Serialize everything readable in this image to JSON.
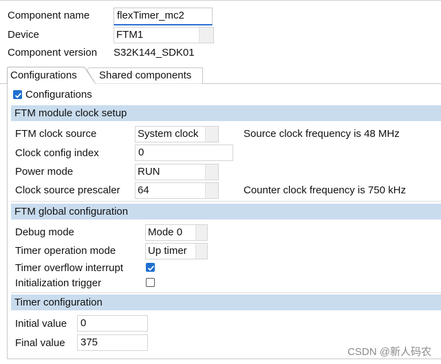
{
  "component": {
    "name_label": "Component name",
    "name_value": "flexTimer_mc2",
    "device_label": "Device",
    "device_value": "FTM1",
    "version_label": "Component version",
    "version_value": "S32K144_SDK01"
  },
  "tabs": [
    {
      "label": "Configurations",
      "active": true
    },
    {
      "label": "Shared components",
      "active": false
    }
  ],
  "configurations_checkbox": {
    "label": "Configurations",
    "checked": true
  },
  "clock_setup": {
    "title": "FTM module clock setup",
    "clock_source_label": "FTM clock source",
    "clock_source_value": "System clock",
    "source_freq_text": "Source clock frequency is 48 MHz",
    "config_index_label": "Clock config index",
    "config_index_value": "0",
    "power_mode_label": "Power mode",
    "power_mode_value": "RUN",
    "prescaler_label": "Clock source prescaler",
    "prescaler_value": "64",
    "counter_freq_text": "Counter clock frequency is 750 kHz"
  },
  "global_config": {
    "title": "FTM global configuration",
    "debug_mode_label": "Debug mode",
    "debug_mode_value": "Mode 0",
    "operation_mode_label": "Timer operation mode",
    "operation_mode_value": "Up timer",
    "overflow_label": "Timer overflow interrupt",
    "overflow_checked": true,
    "init_trigger_label": "Initialization trigger",
    "init_trigger_checked": false
  },
  "timer_config": {
    "title": "Timer configuration",
    "initial_label": "Initial value",
    "initial_value": "0",
    "final_label": "Final value",
    "final_value": "375"
  },
  "watermark": "CSDN @新人码农",
  "colors": {
    "section_bg": "#c9dcee",
    "checkbox_on": "#1f6fd1",
    "focus_underline": "#2b6fcf"
  }
}
